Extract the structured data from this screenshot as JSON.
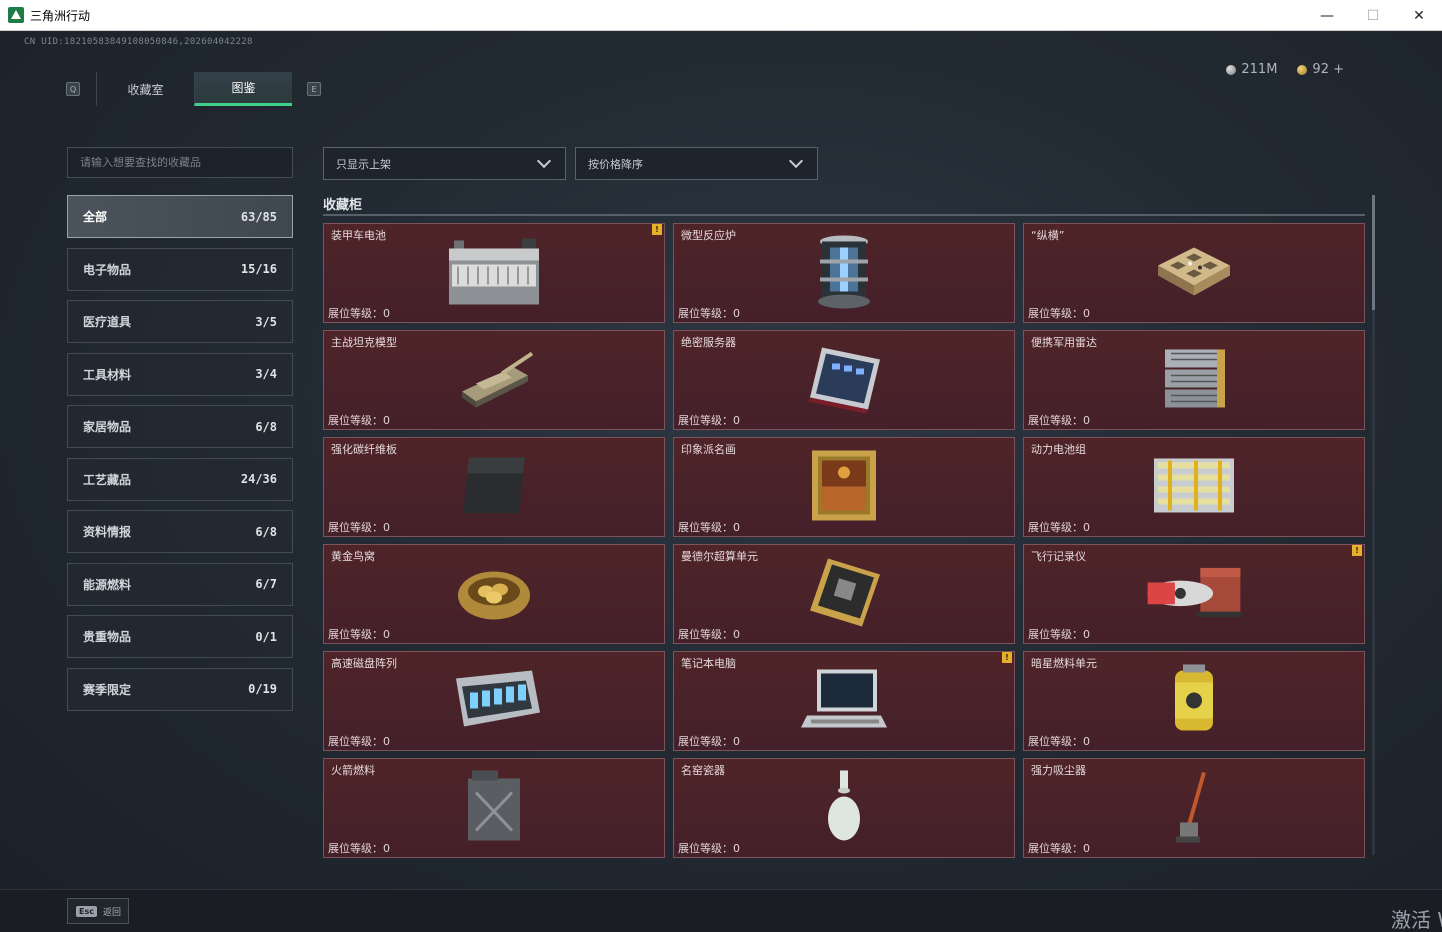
{
  "window": {
    "title": "三角洲行动",
    "minimize": "—",
    "maximize": "☐",
    "close": "✕"
  },
  "header": {
    "uid": "CN UID:1821058384910805084​6,202604042228",
    "silver": "211M",
    "gold": "92 +",
    "key_left": "Q",
    "key_right": "E"
  },
  "tabs": [
    {
      "label": "收藏室",
      "active": false
    },
    {
      "label": "图鉴",
      "active": true
    }
  ],
  "search": {
    "placeholder": "请输入想要查找的收藏品"
  },
  "categories": [
    {
      "label": "全部",
      "count": "63/85",
      "active": true
    },
    {
      "label": "电子物品",
      "count": "15/16"
    },
    {
      "label": "医疗道具",
      "count": "3/5"
    },
    {
      "label": "工具材料",
      "count": "3/4"
    },
    {
      "label": "家居物品",
      "count": "6/8"
    },
    {
      "label": "工艺藏品",
      "count": "24/36"
    },
    {
      "label": "资料情报",
      "count": "6/8"
    },
    {
      "label": "能源燃料",
      "count": "6/7"
    },
    {
      "label": "贵重物品",
      "count": "0/1"
    },
    {
      "label": "赛季限定",
      "count": "0/19"
    }
  ],
  "filters": {
    "availability": "只显示上架",
    "sort": "按价格降序"
  },
  "section": {
    "title": "收藏柜"
  },
  "items": [
    {
      "name": "装甲车电池",
      "level": "展位等级：0",
      "warn": true,
      "icon": "battery-icon",
      "warn_text": "!"
    },
    {
      "name": "微型反应炉",
      "level": "展位等级：0",
      "warn": false,
      "icon": "reactor-icon"
    },
    {
      "name": "“纵横”",
      "level": "展位等级：0",
      "warn": false,
      "icon": "chessboard-icon"
    },
    {
      "name": "主战坦克模型",
      "level": "展位等级：0",
      "warn": false,
      "icon": "tank-icon"
    },
    {
      "name": "绝密服务器",
      "level": "展位等级：0",
      "warn": false,
      "icon": "server-icon"
    },
    {
      "name": "便携军用雷达",
      "level": "展位等级：0",
      "warn": false,
      "icon": "radar-icon"
    },
    {
      "name": "强化碳纤维板",
      "level": "展位等级：0",
      "warn": false,
      "icon": "carbon-plate-icon"
    },
    {
      "name": "印象派名画",
      "level": "展位等级：0",
      "warn": false,
      "icon": "painting-icon"
    },
    {
      "name": "动力电池组",
      "level": "展位等级：0",
      "warn": false,
      "icon": "battery-pack-icon"
    },
    {
      "name": "黄金鸟窝",
      "level": "展位等级：0",
      "warn": false,
      "icon": "golden-nest-icon"
    },
    {
      "name": "曼德尔超算单元",
      "level": "展位等级：0",
      "warn": false,
      "icon": "compute-unit-icon"
    },
    {
      "name": "飞行记录仪",
      "level": "展位等级：0",
      "warn": true,
      "icon": "flight-recorder-icon",
      "warn_text": "!"
    },
    {
      "name": "高速磁盘阵列",
      "level": "展位等级：0",
      "warn": false,
      "icon": "disk-array-icon"
    },
    {
      "name": "笔记本电脑",
      "level": "展位等级：0",
      "warn": true,
      "icon": "laptop-icon",
      "warn_text": "!"
    },
    {
      "name": "暗星燃料单元",
      "level": "展位等级：0",
      "warn": false,
      "icon": "fuel-cell-icon"
    },
    {
      "name": "火箭燃料",
      "level": "展位等级：0",
      "warn": false,
      "icon": "jerrycan-icon"
    },
    {
      "name": "名窑瓷器",
      "level": "展位等级：0",
      "warn": false,
      "icon": "vase-icon"
    },
    {
      "name": "强力吸尘器",
      "level": "展位等级：0",
      "warn": false,
      "icon": "vacuum-icon"
    }
  ],
  "footer": {
    "esc_key": "Esc",
    "esc_label": "返回",
    "watermark": "激活 W"
  },
  "colors": {
    "accent": "#3fd08a",
    "card_bg": "#4a2228",
    "warn": "#e6b02a"
  }
}
